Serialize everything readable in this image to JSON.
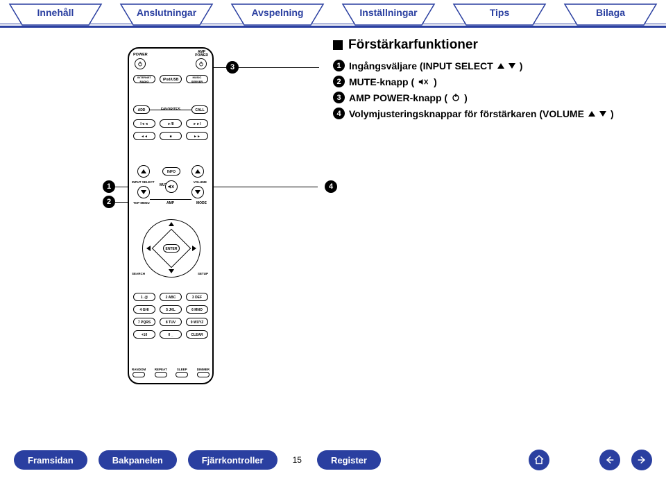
{
  "tabs": [
    "Innehåll",
    "Anslutningar",
    "Avspelning",
    "Inställningar",
    "Tips",
    "Bilaga"
  ],
  "section": {
    "heading": "Förstärkarfunktioner",
    "items": [
      {
        "n": "1",
        "label": "Ingångsväljare (INPUT SELECT ",
        "suffix": ")",
        "icon": "updown"
      },
      {
        "n": "2",
        "label": "MUTE-knapp (",
        "suffix": ")",
        "icon": "mute"
      },
      {
        "n": "3",
        "label": "AMP POWER-knapp (",
        "suffix": ")",
        "icon": "power"
      },
      {
        "n": "4",
        "label": "Volymjusteringsknappar för förstärkaren (VOLUME ",
        "suffix": ")",
        "icon": "updown"
      }
    ]
  },
  "callouts": {
    "c1": "1",
    "c2": "2",
    "c3": "3",
    "c4": "4"
  },
  "remote": {
    "power_label": "POWER",
    "amp_power_label": "AMP POWER",
    "row2": [
      "INTERNET RADIO",
      "iPod/USB",
      "MUSIC SERVER"
    ],
    "fav_row": [
      "ADD",
      "FAVORITES",
      "CALL"
    ],
    "amp_cluster": {
      "input_select": "INPUT SELECT",
      "info": "INFO",
      "mute": "MUTE",
      "volume": "VOLUME",
      "top_menu": "TOP MENU",
      "amp": "AMP",
      "mode": "MODE"
    },
    "enter_cluster": {
      "enter": "ENTER",
      "search": "SEARCH",
      "setup": "SETUP"
    },
    "numpad": [
      [
        "1 .@",
        "2 ABC",
        "3 DEF"
      ],
      [
        "4 GHI",
        "5 JKL",
        "6 MNO"
      ],
      [
        "7 PQRS",
        "8 TUV",
        "9 WXYZ"
      ],
      [
        "+10",
        "0 _",
        "CLEAR"
      ]
    ],
    "bottom_row": [
      "RANDOM",
      "REPEAT",
      "SLEEP",
      "DIMMER"
    ]
  },
  "bottom": {
    "buttons": [
      "Framsidan",
      "Bakpanelen",
      "Fjärrkontroller",
      "Register"
    ],
    "page": "15"
  }
}
